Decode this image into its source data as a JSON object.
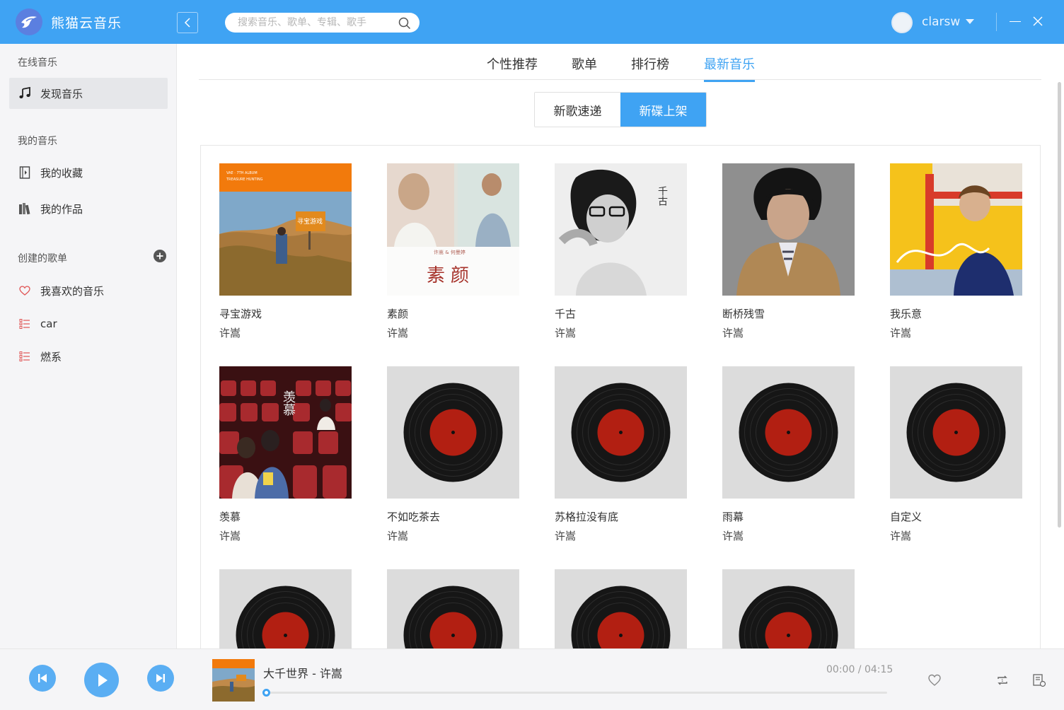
{
  "app": {
    "title": "熊猫云音乐"
  },
  "header": {
    "search_placeholder": "搜索音乐、歌单、专辑、歌手",
    "username": "clarsw"
  },
  "sidebar": {
    "online_title": "在线音乐",
    "discover_label": "发现音乐",
    "my_music_title": "我的音乐",
    "favorites_label": "我的收藏",
    "works_label": "我的作品",
    "created_title": "创建的歌单",
    "playlists": [
      "我喜欢的音乐",
      "car",
      "燃系"
    ]
  },
  "tabs": [
    "个性推荐",
    "歌单",
    "排行榜",
    "最新音乐"
  ],
  "active_tab": "最新音乐",
  "segment": {
    "options": [
      "新歌速递",
      "新碟上架"
    ],
    "active": "新碟上架"
  },
  "albums": [
    {
      "title": "寻宝游戏",
      "artist": "许嵩"
    },
    {
      "title": "素颜",
      "artist": "许嵩"
    },
    {
      "title": "千古",
      "artist": "许嵩"
    },
    {
      "title": "断桥残雪",
      "artist": "许嵩"
    },
    {
      "title": "我乐意",
      "artist": "许嵩"
    },
    {
      "title": "羡慕",
      "artist": "许嵩"
    },
    {
      "title": "不如吃茶去",
      "artist": "许嵩"
    },
    {
      "title": "苏格拉没有底",
      "artist": "许嵩"
    },
    {
      "title": "雨幕",
      "artist": "许嵩"
    },
    {
      "title": "自定义",
      "artist": "许嵩"
    }
  ],
  "cover_text": {
    "album1_tag": "VAE · 7TH ALBUM",
    "album1_tag2": "TREASURE HUNTING",
    "album1_sign": "寻宝游戏",
    "album2_credit": "许嵩 & 何曼婷",
    "album2_big": "素颜",
    "album3_big": "千古",
    "album6_big": "羡慕"
  },
  "player": {
    "track": "大千世界 - 许嵩",
    "time": "00:00 / 04:15",
    "progress": 0
  },
  "colors": {
    "accent": "#3fa3f3",
    "sidebar_bg": "#f5f5f7",
    "vinyl_red": "#b21f12"
  }
}
